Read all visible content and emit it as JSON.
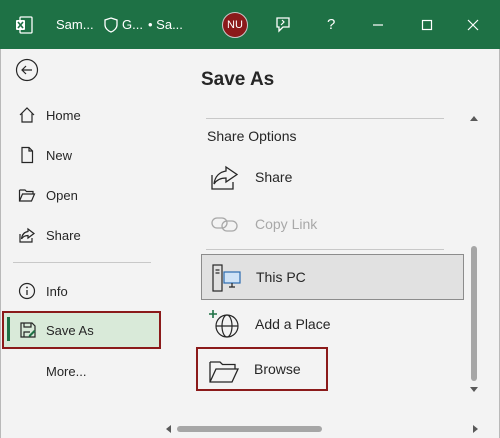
{
  "titlebar": {
    "filename": "Sam...",
    "sensitivity": "G...",
    "status": "• Sa...",
    "avatar_initials": "NU",
    "help": "?"
  },
  "nav": {
    "items": [
      {
        "label": "Home"
      },
      {
        "label": "New"
      },
      {
        "label": "Open"
      },
      {
        "label": "Share"
      },
      {
        "label": "Info"
      },
      {
        "label": "Save As"
      },
      {
        "label": "More..."
      }
    ]
  },
  "main": {
    "title": "Save As",
    "share_options_title": "Share Options",
    "share_label": "Share",
    "copy_link_label": "Copy Link",
    "this_pc_label": "This PC",
    "add_place_label": "Add a Place",
    "browse_label": "Browse"
  },
  "colors": {
    "accent": "#1e7145",
    "highlight_border": "#8b1a1a",
    "avatar_bg": "#8b1a1a"
  }
}
